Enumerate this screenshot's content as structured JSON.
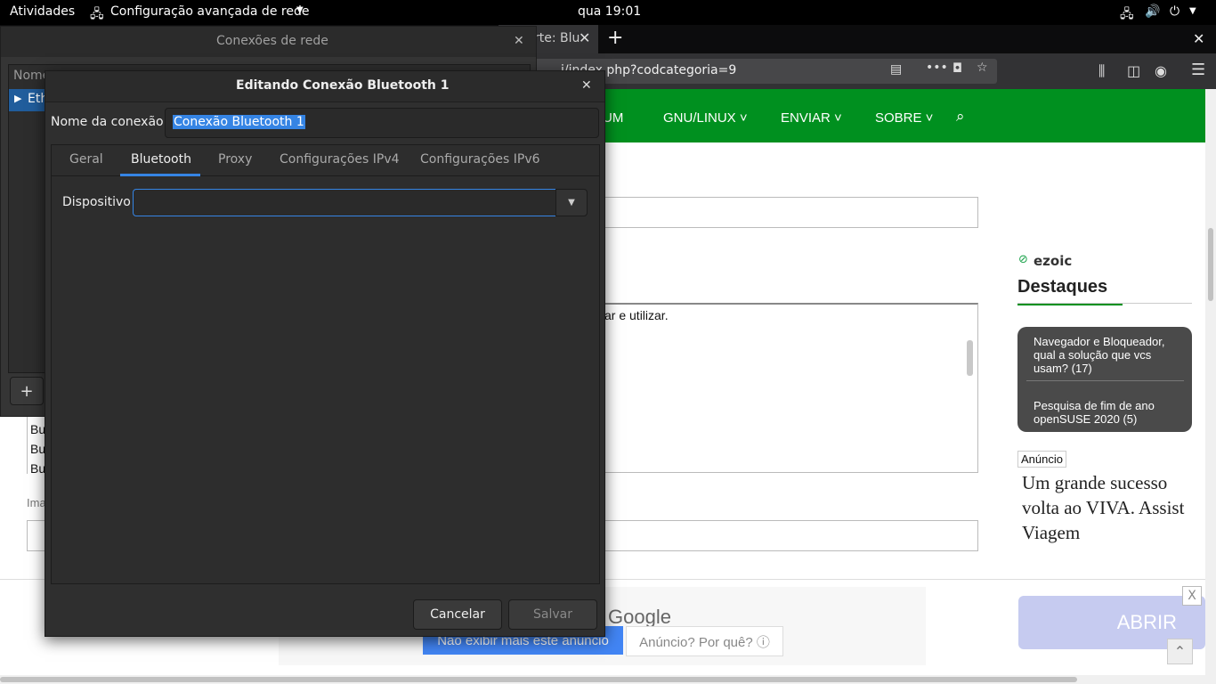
{
  "topbar": {
    "activities": "Atividades",
    "app_menu": "Configuração avançada de rede",
    "clock": "qua 19:01"
  },
  "firefox": {
    "tab_partial": "rte: Blu",
    "url_partial": "i/index.php?codcategoria=9"
  },
  "site": {
    "nav": [
      "UM",
      "GNU/LINUX",
      "ENVIAR",
      "SOBRE"
    ],
    "textarea_partial": "ar e utilizar.",
    "left_list": [
      "Bu",
      "Bu",
      "Bu"
    ],
    "label_partial": "Ima",
    "ezoic": "ezoic",
    "destaques_title": "Destaques",
    "destaques": [
      "Navegador e Bloqueador, qual a solução que vcs usam? (17)",
      "Pesquisa de fim de ano openSUSE 2020 (5)"
    ],
    "anuncio_label": "Anúncio",
    "ad_text": "Um grande sucesso volta ao VIVA. Assist Viagem",
    "ad_google": "Google",
    "ad_hide": "Não exibir mais este anúncio",
    "ad_why": "Anúncio? Por quê? ⓘ",
    "ad_close": "X",
    "ad_open": "ABRIR"
  },
  "netwin": {
    "title": "Conexões de rede",
    "col_header": "Nome",
    "row": "Eth",
    "add": "+"
  },
  "dialog": {
    "title": "Editando Conexão Bluetooth 1",
    "conn_name_label": "Nome da conexão",
    "conn_name_value": "Conexão Bluetooth 1",
    "tabs": [
      "Geral",
      "Bluetooth",
      "Proxy",
      "Configurações IPv4",
      "Configurações IPv6"
    ],
    "device_label": "Dispositivo",
    "device_value": "",
    "cancel": "Cancelar",
    "save": "Salvar"
  },
  "colors": {
    "site_green": "#00901f",
    "dialog_bg": "#2f2f2f",
    "accent_blue": "#3584e4"
  }
}
